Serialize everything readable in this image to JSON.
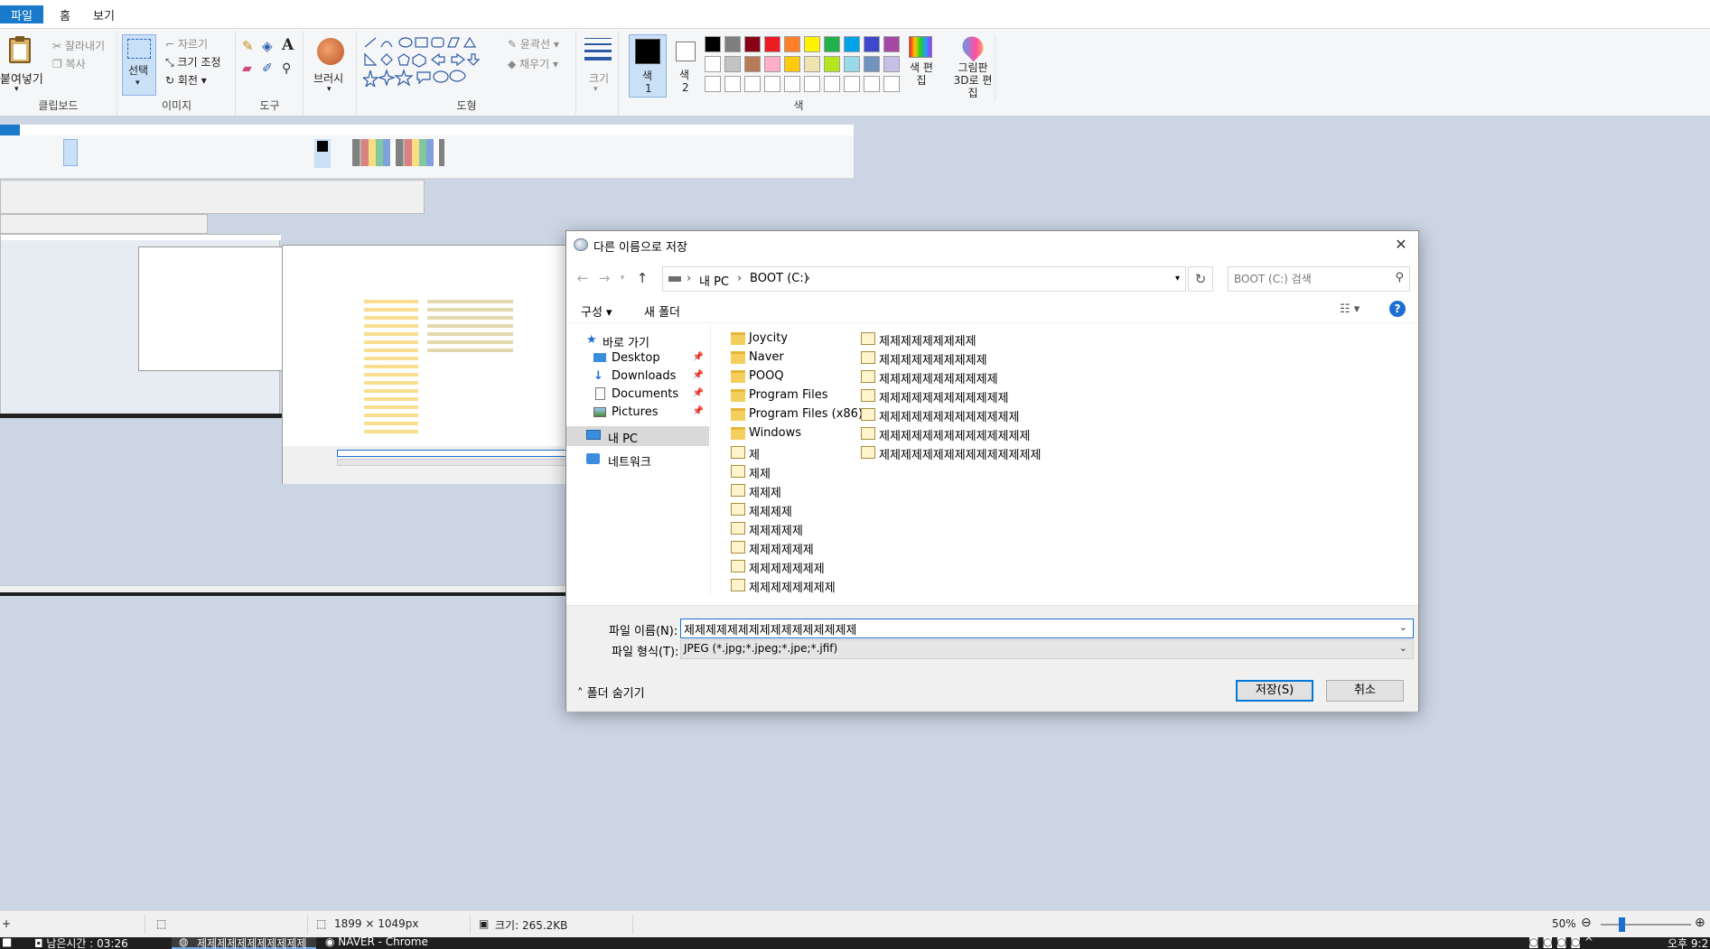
{
  "tabs": {
    "file": "파일",
    "home": "홈",
    "view": "보기"
  },
  "ribbon": {
    "clipboard": {
      "paste": "붙여넣기",
      "cut": "잘라내기",
      "copy": "복사",
      "label": "클립보드"
    },
    "image": {
      "select": "선택",
      "crop": "자르기",
      "resize": "크기 조정",
      "rotate": "회전",
      "label": "이미지"
    },
    "tools": {
      "label": "도구"
    },
    "brush": {
      "label": "브러시"
    },
    "shapes": {
      "outline": "윤곽선",
      "fill": "채우기",
      "label": "도형"
    },
    "size": {
      "label": "크기"
    },
    "color1": {
      "label": "색",
      "num": "1"
    },
    "color2": {
      "label": "색",
      "num": "2"
    },
    "colors": {
      "label": "색",
      "row1": [
        "#000000",
        "#7f7f7f",
        "#880015",
        "#ed1c24",
        "#ff7f27",
        "#fff200",
        "#22b14c",
        "#00a2e8",
        "#3f48cc",
        "#a349a4"
      ],
      "row2": [
        "#ffffff",
        "#c3c3c3",
        "#b97a57",
        "#ffaec9",
        "#ffc90e",
        "#efe4b0",
        "#b5e61d",
        "#99d9ea",
        "#7092be",
        "#c8bfe7"
      ],
      "row3": [
        "#ffffff",
        "#ffffff",
        "#ffffff",
        "#ffffff",
        "#ffffff",
        "#ffffff",
        "#ffffff",
        "#ffffff",
        "#ffffff",
        "#ffffff"
      ]
    },
    "edit_colors": {
      "label": "색 편집"
    },
    "paint3d": {
      "label": "그림판 3D로 편집"
    }
  },
  "dialog": {
    "title": "다른 이름으로 저장",
    "breadcrumb": [
      "내 PC",
      "BOOT (C:)"
    ],
    "search_placeholder": "BOOT (C:) 검색",
    "organize": "구성",
    "new_folder": "새 폴더",
    "nav": {
      "quick_access": "바로 가기",
      "desktop": "Desktop",
      "downloads": "Downloads",
      "documents": "Documents",
      "pictures": "Pictures",
      "this_pc": "내 PC",
      "network": "네트워크"
    },
    "files_col1": [
      {
        "name": "Joycity",
        "type": "folder"
      },
      {
        "name": "Naver",
        "type": "folder"
      },
      {
        "name": "POOQ",
        "type": "folder"
      },
      {
        "name": "Program Files",
        "type": "folder"
      },
      {
        "name": "Program Files (x86)",
        "type": "folder"
      },
      {
        "name": "Windows",
        "type": "folder"
      },
      {
        "name": "제",
        "type": "image"
      },
      {
        "name": "제제",
        "type": "image"
      },
      {
        "name": "제제제",
        "type": "image"
      },
      {
        "name": "제제제제",
        "type": "image"
      },
      {
        "name": "제제제제제",
        "type": "image"
      },
      {
        "name": "제제제제제제",
        "type": "image"
      },
      {
        "name": "제제제제제제제",
        "type": "image"
      },
      {
        "name": "제제제제제제제제",
        "type": "image"
      }
    ],
    "files_col2": [
      {
        "name": "제제제제제제제제제",
        "type": "image"
      },
      {
        "name": "제제제제제제제제제제",
        "type": "image"
      },
      {
        "name": "제제제제제제제제제제제",
        "type": "image"
      },
      {
        "name": "제제제제제제제제제제제제",
        "type": "image"
      },
      {
        "name": "제제제제제제제제제제제제제",
        "type": "image"
      },
      {
        "name": "제제제제제제제제제제제제제제",
        "type": "image"
      },
      {
        "name": "제제제제제제제제제제제제제제제",
        "type": "image"
      }
    ],
    "filename_label": "파일 이름(N):",
    "filename_value": "제제제제제제제제제제제제제제제제",
    "filetype_label": "파일 형식(T):",
    "filetype_value": "JPEG (*.jpg;*.jpeg;*.jpe;*.jfif)",
    "hide_folders": "폴더 숨기기",
    "save": "저장(S)",
    "cancel": "취소"
  },
  "status": {
    "dimensions": "1899 × 1049px",
    "size": "크기: 265.2KB",
    "zoom": "50%"
  },
  "taskbar": {
    "timer": "남은시간 : 03:26",
    "paint_window": "제제제제제제제제제제제",
    "chrome_window": "NAVER - Chrome",
    "clock": "오후 9:2"
  }
}
